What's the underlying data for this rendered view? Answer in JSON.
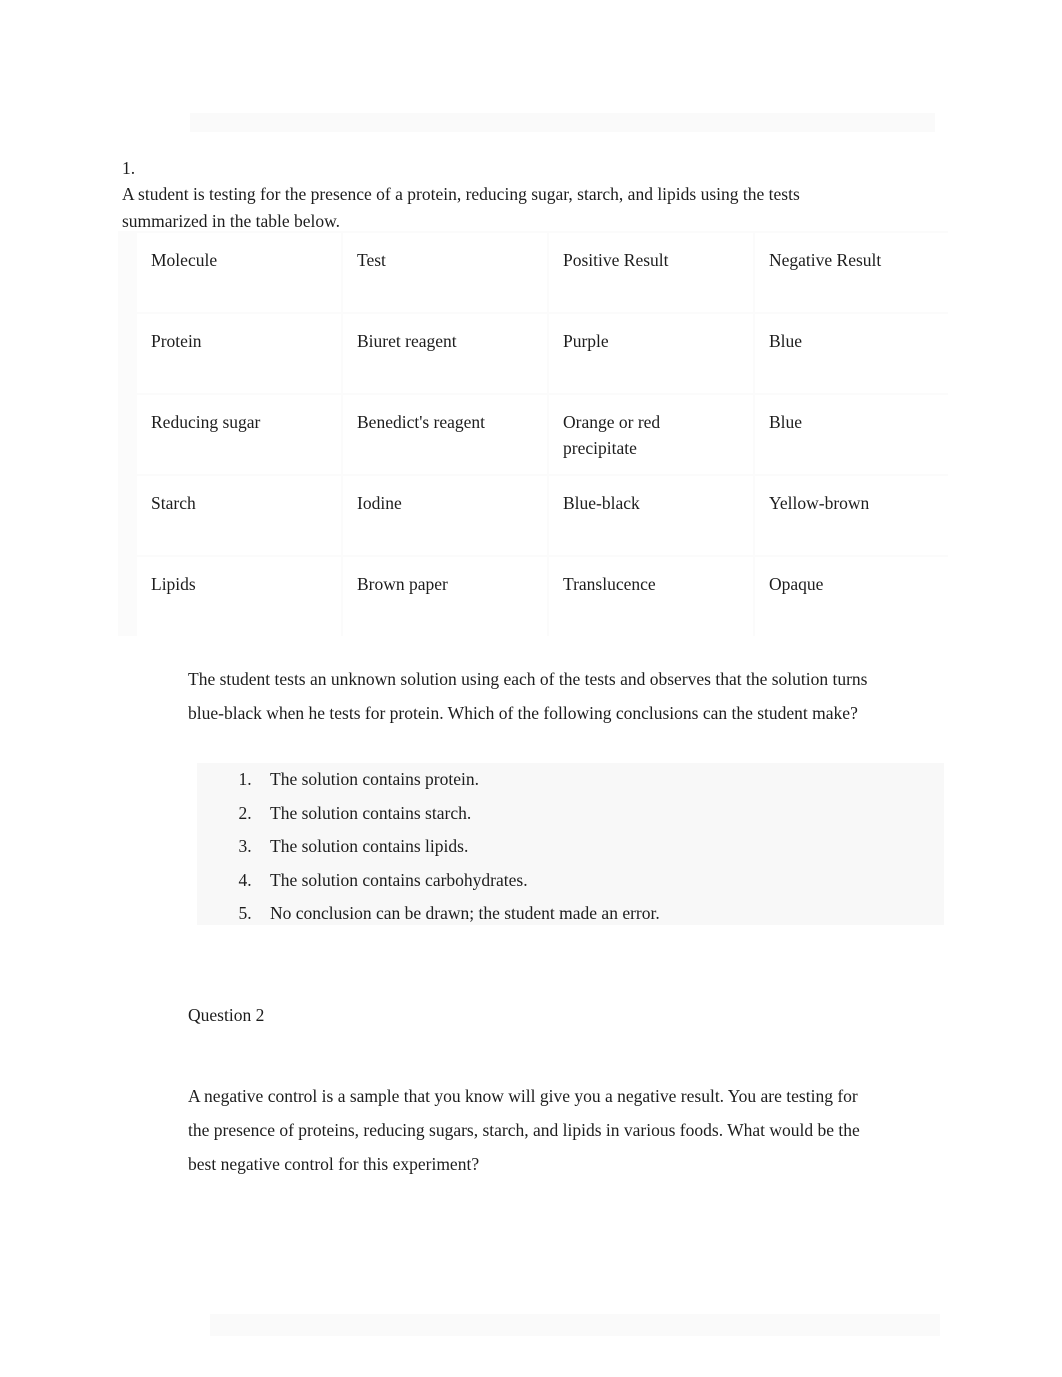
{
  "document": {
    "question1": {
      "number": "1.",
      "intro": "A student is testing for the presence of a protein, reducing sugar, starch, and lipids using the tests summarized in the table below.",
      "table": {
        "headers": [
          "Molecule",
          "Test",
          "Positive Result",
          "Negative Result"
        ],
        "rows": [
          {
            "molecule": "Protein",
            "test": "Biuret reagent",
            "positive": "Purple",
            "positive_cont": "",
            "negative": "Blue"
          },
          {
            "molecule": "Reducing sugar",
            "test": "Benedict's reagent",
            "positive": "Orange or red",
            "positive_cont": "precipitate",
            "negative": "Blue"
          },
          {
            "molecule": "Starch",
            "test": "Iodine",
            "positive": "Blue-black",
            "positive_cont": "",
            "negative": "Yellow-brown"
          },
          {
            "molecule": "Lipids",
            "test": "Brown paper",
            "positive": "Translucence",
            "positive_cont": "",
            "negative": "Opaque"
          }
        ]
      },
      "stem": "The student tests an unknown solution using each of the tests and observes that the solution turns blue-black when he tests for protein. Which of the following conclusions can the student make?",
      "answers": [
        "The solution contains protein.",
        "The solution contains starch.",
        "The solution contains lipids.",
        "The solution contains carbohydrates.",
        "No conclusion can be drawn; the student made an error."
      ]
    },
    "question2": {
      "title": "Question 2",
      "body": "A negative control is a sample that you know will give you a negative result. You are testing for the presence of proteins, reducing sugars, starch, and lipids in various foods. What would be the best negative control for this experiment?"
    }
  }
}
